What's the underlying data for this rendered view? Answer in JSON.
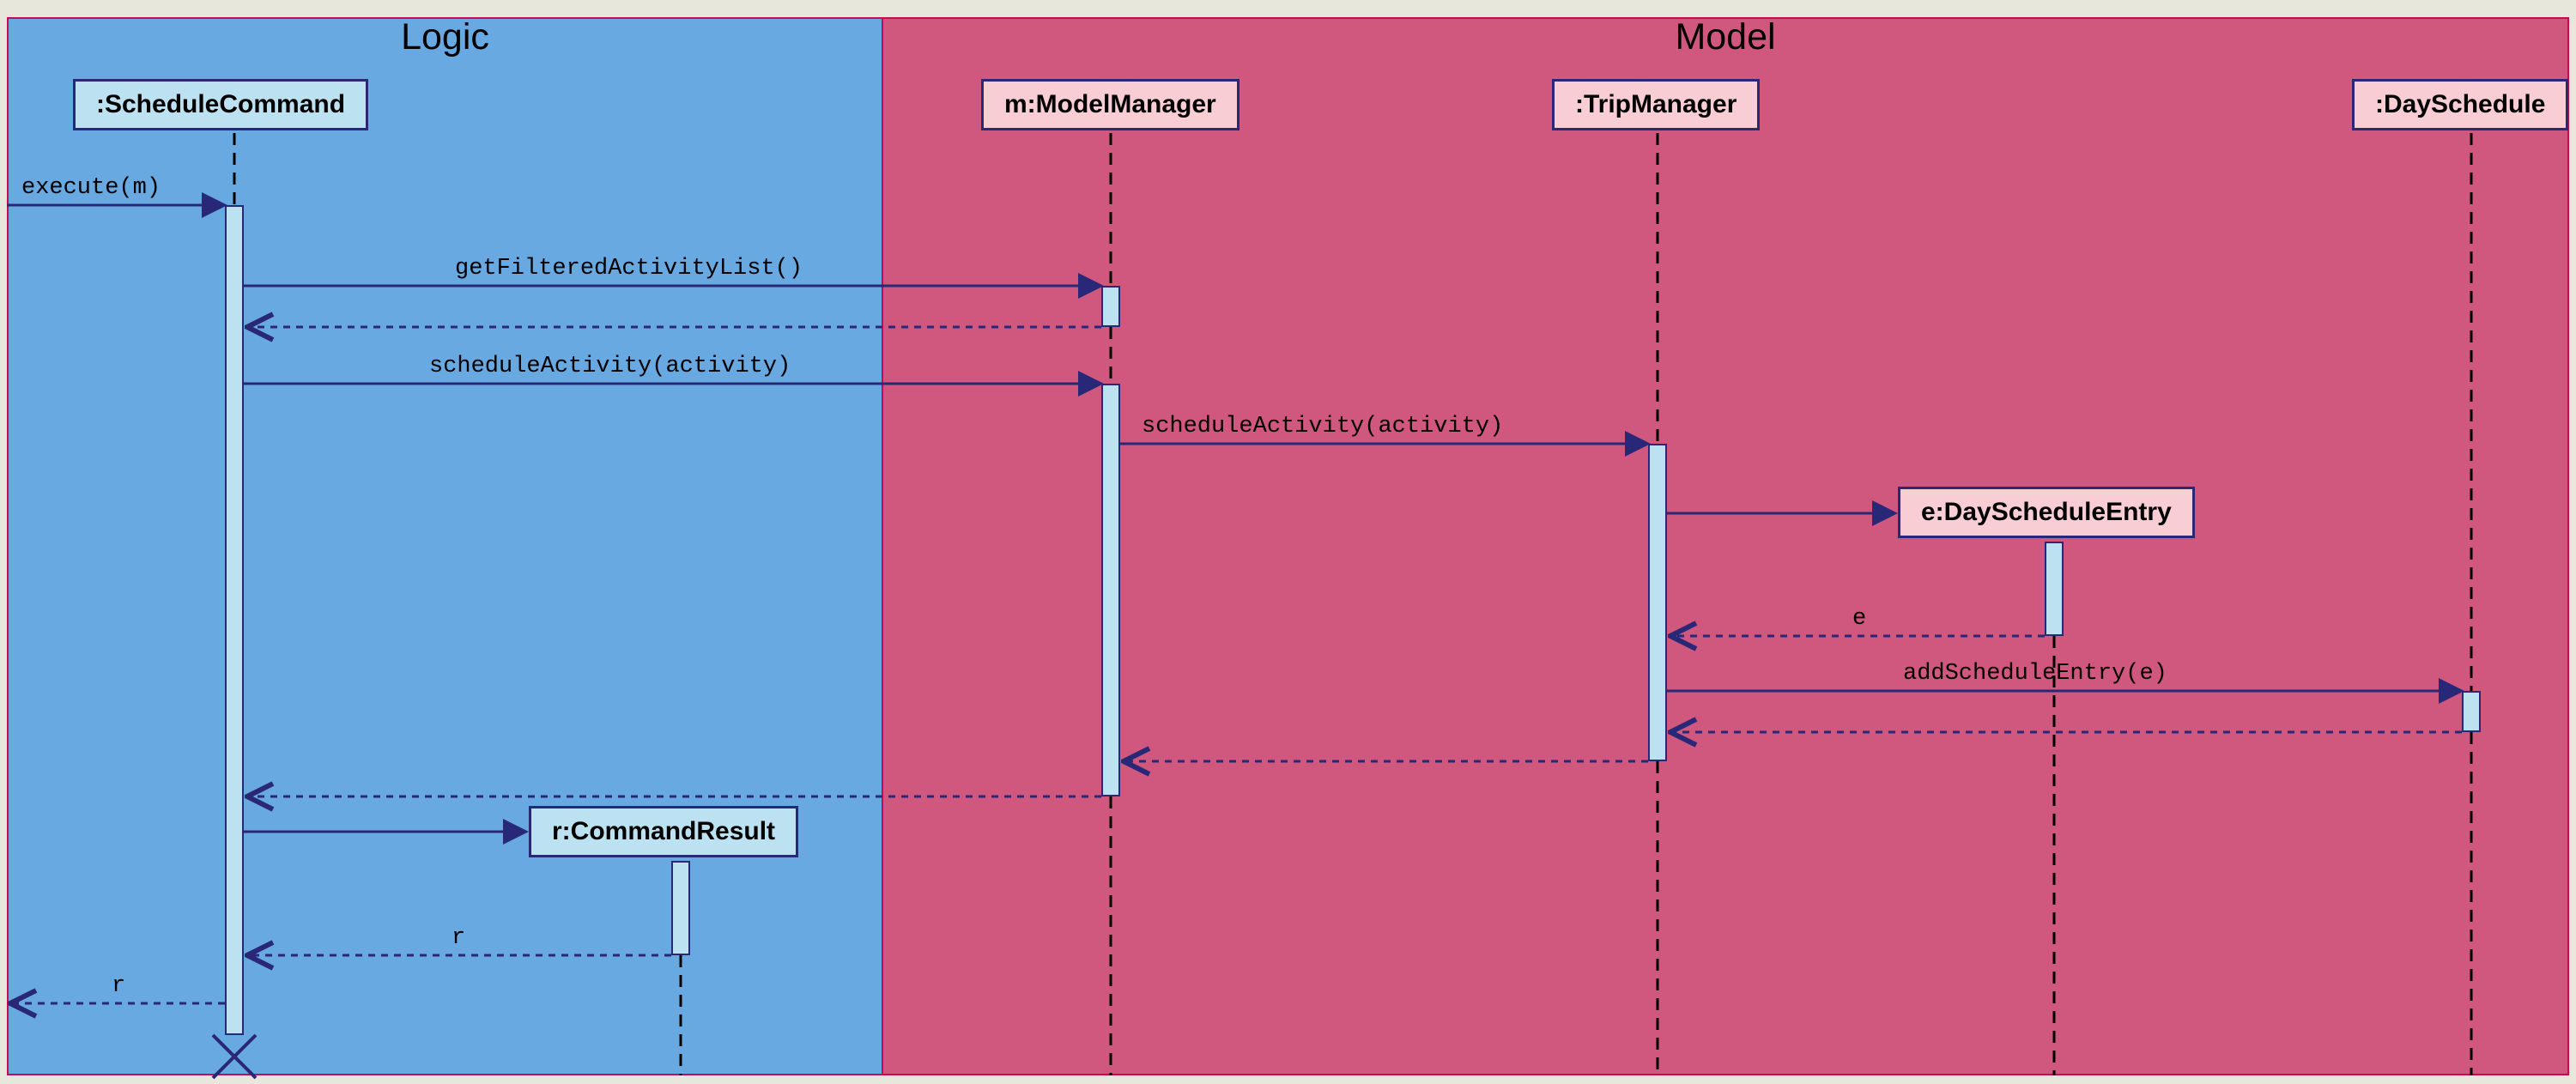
{
  "frames": {
    "logic": {
      "title": "Logic"
    },
    "model": {
      "title": "Model"
    }
  },
  "participants": {
    "scheduleCommand": {
      "label": ":ScheduleCommand"
    },
    "modelManager": {
      "label": "m:ModelManager"
    },
    "tripManager": {
      "label": ":TripManager"
    },
    "daySchedule": {
      "label": ":DaySchedule"
    },
    "dayScheduleEntry": {
      "label": "e:DayScheduleEntry"
    },
    "commandResult": {
      "label": "r:CommandResult"
    }
  },
  "messages": {
    "execute": "execute(m)",
    "getFilteredActivityList": "getFilteredActivityList()",
    "scheduleActivity1": "scheduleActivity(activity)",
    "scheduleActivity2": "scheduleActivity(activity)",
    "return_e": "e",
    "addScheduleEntry": "addScheduleEntry(e)",
    "return_r1": "r",
    "return_r2": "r"
  }
}
